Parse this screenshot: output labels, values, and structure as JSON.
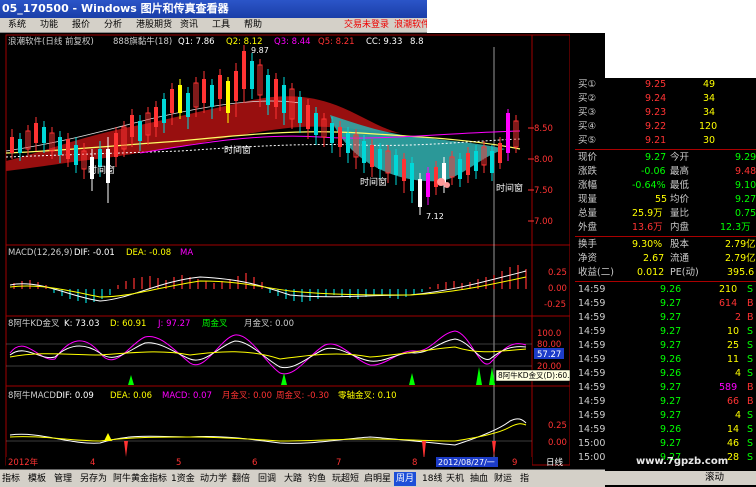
{
  "window": {
    "title": "05_170500 - Windows 图片和传真查看器"
  },
  "menu": {
    "items": [
      "系统",
      "功能",
      "报价",
      "分析",
      "港股期货",
      "资讯",
      "工具",
      "帮助"
    ],
    "alerts": [
      "交易未登录",
      "浪潮软件"
    ]
  },
  "chart_header": {
    "stock": "浪潮软件(日线 前复权)",
    "indicator": "888旗黏牛(18)",
    "q1": "Q1: 7.86",
    "q2": "Q2: 8.12",
    "q3": "Q3: 8.44",
    "q5": "Q5: 8.21",
    "cc": "CC: 9.33",
    "last": "8.8"
  },
  "price_axis": [
    "8.50",
    "8.00",
    "7.50",
    "7.00"
  ],
  "price_marks": {
    "high": "9.87",
    "low": "7.12"
  },
  "annotations": [
    "时间窗",
    "时间窗",
    "时间窗",
    "时间窗"
  ],
  "macd_panel": {
    "header": "MACD(12,26,9)",
    "dif": "DIF: -0.01",
    "dea": "DEA: -0.08",
    "ma": "MA",
    "axis": [
      "0.25",
      "0.00",
      "-0.25"
    ]
  },
  "kd_panel": {
    "header": "8阿牛KD金叉",
    "k": "K: 73.03",
    "d": "D: 60.91",
    "j": "J: 97.27",
    "zhou": "周金叉",
    "yue": "月金叉: 0.00",
    "axis": [
      "100.0",
      "80.00",
      "57.27",
      "20.00",
      "0.00"
    ],
    "tooltip": "8阿牛KD金叉(D):60.91"
  },
  "macd2_panel": {
    "header": "8阿牛MACD",
    "dif": "DIF: 0.09",
    "dea": "DEA: 0.06",
    "macd": "MACD: 0.07",
    "yue": "月金叉: 0.00",
    "zhou": "周金叉: -0.30",
    "zero": "零轴金叉: 0.10",
    "axis": [
      "0.25",
      "0.00"
    ]
  },
  "time_axis": {
    "year": "2012年",
    "m4": "4",
    "m5": "5",
    "m6": "6",
    "m7": "7",
    "m8": "8",
    "cursor": "2012/08/27/一",
    "m9": "9",
    "period": "日线"
  },
  "quote": {
    "book": [
      {
        "label": "买①",
        "price": "9.25",
        "vol": "49"
      },
      {
        "label": "买②",
        "price": "9.24",
        "vol": "34"
      },
      {
        "label": "买③",
        "price": "9.23",
        "vol": "34"
      },
      {
        "label": "买④",
        "price": "9.22",
        "vol": "120"
      },
      {
        "label": "买⑤",
        "price": "9.21",
        "vol": "30"
      }
    ],
    "stats": [
      {
        "l1": "现价",
        "v1": "9.27",
        "l2": "今开",
        "v2": "9.29"
      },
      {
        "l1": "涨跌",
        "v1": "-0.06",
        "l2": "最高",
        "v2": "9.48"
      },
      {
        "l1": "涨幅",
        "v1": "-0.64%",
        "l2": "最低",
        "v2": "9.10"
      },
      {
        "l1": "现量",
        "v1": "55",
        "l2": "均价",
        "v2": "9.27"
      },
      {
        "l1": "总量",
        "v1": "25.9万",
        "l2": "量比",
        "v2": "0.75"
      },
      {
        "l1": "外盘",
        "v1": "13.6万",
        "l2": "内盘",
        "v2": "12.3万"
      }
    ],
    "fund": [
      {
        "l1": "换手",
        "v1": "9.30%",
        "l2": "股本",
        "v2": "2.79亿"
      },
      {
        "l1": "净资",
        "v1": "2.67",
        "l2": "流通",
        "v2": "2.79亿"
      },
      {
        "l1": "收益(二)",
        "v1": "0.012",
        "l2": "PE(动)",
        "v2": "395.6"
      }
    ],
    "ticks": [
      {
        "t": "14:59",
        "p": "9.26",
        "v": "210",
        "s": "S"
      },
      {
        "t": "14:59",
        "p": "9.27",
        "v": "614",
        "s": "B"
      },
      {
        "t": "14:59",
        "p": "9.27",
        "v": "2",
        "s": "B"
      },
      {
        "t": "14:59",
        "p": "9.27",
        "v": "10",
        "s": "S"
      },
      {
        "t": "14:59",
        "p": "9.27",
        "v": "25",
        "s": "S"
      },
      {
        "t": "14:59",
        "p": "9.26",
        "v": "11",
        "s": "S"
      },
      {
        "t": "14:59",
        "p": "9.26",
        "v": "4",
        "s": "S"
      },
      {
        "t": "14:59",
        "p": "9.27",
        "v": "589",
        "s": "B"
      },
      {
        "t": "14:59",
        "p": "9.27",
        "v": "66",
        "s": "B"
      },
      {
        "t": "14:59",
        "p": "9.27",
        "v": "4",
        "s": "S"
      },
      {
        "t": "14:59",
        "p": "9.26",
        "v": "14",
        "s": "S"
      },
      {
        "t": "15:00",
        "p": "9.27",
        "v": "46",
        "s": "S"
      },
      {
        "t": "15:00",
        "p": "9.27",
        "v": "28",
        "s": "S"
      }
    ],
    "footer": "滚动"
  },
  "bottom_tabs": [
    "指标",
    "模板",
    "管理",
    "另存为",
    "阿牛黄金指标",
    "1资金",
    "动力学",
    "翻倍",
    "回调",
    "大踏",
    "钓鱼",
    "玩超短",
    "启明星",
    "周月",
    "18线",
    "天机",
    "抽血",
    "财运",
    "指"
  ],
  "watermark": "www.7gpzb.com",
  "colors": {
    "up": "#ff3333",
    "down": "#00d8d8",
    "yellow": "#ffff00",
    "magenta": "#ff00ff",
    "green": "#00ff00",
    "white": "#ffffff"
  }
}
